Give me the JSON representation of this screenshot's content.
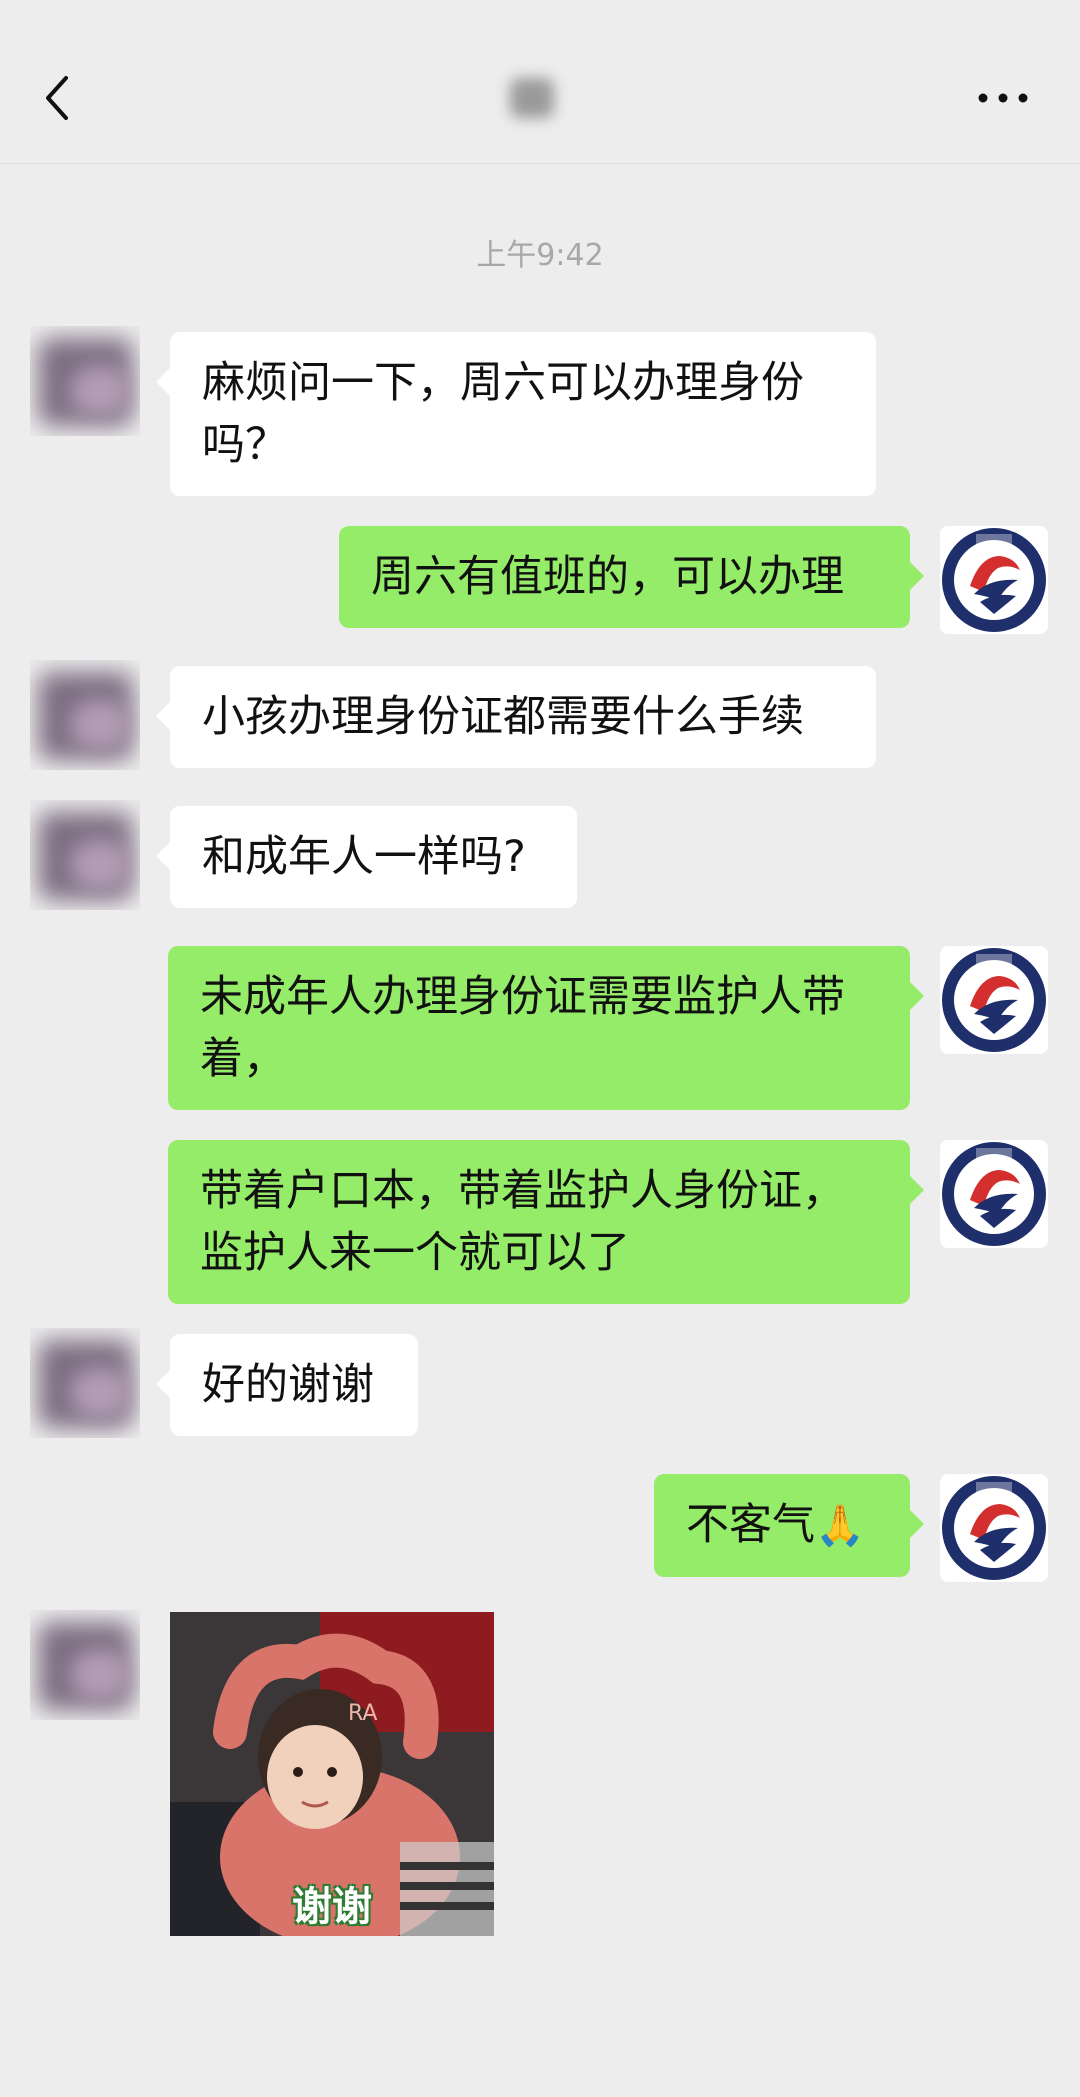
{
  "header": {
    "back_icon": "chevron-left-icon",
    "more_icon": "more-dots-icon"
  },
  "timestamp": "上午9:42",
  "messages": [
    {
      "side": "left",
      "text": "麻烦问一下，周六可以办理身份吗？"
    },
    {
      "side": "right",
      "text": "周六有值班的，可以办理"
    },
    {
      "side": "left",
      "text": "小孩办理身份证都需要什么手续"
    },
    {
      "side": "left",
      "text": "和成年人一样吗?"
    },
    {
      "side": "right",
      "text": "未成年人办理身份证需要监护人带着，"
    },
    {
      "side": "right",
      "text": "带着户口本，带着监护人身份证，监护人来一个就可以了"
    },
    {
      "side": "left",
      "text": "好的谢谢"
    },
    {
      "side": "right",
      "text": "不客气",
      "emoji": "🙏"
    },
    {
      "side": "left",
      "sticker_caption": "谢谢"
    }
  ],
  "colors": {
    "background": "#ededed",
    "bubble_self": "#95ec69",
    "bubble_other": "#ffffff",
    "timestamp_text": "#a8a8a8"
  }
}
